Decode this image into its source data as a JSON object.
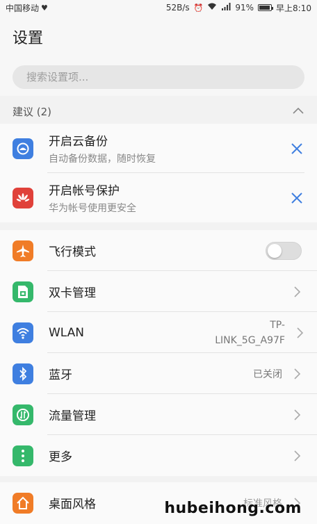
{
  "status_bar": {
    "carrier": "中国移动",
    "speed": "52B/s",
    "battery": "91%",
    "time": "早上8:10"
  },
  "header": {
    "title": "设置"
  },
  "search": {
    "placeholder": "搜索设置项..."
  },
  "suggestions": {
    "header": "建议 (2)",
    "items": [
      {
        "title": "开启云备份",
        "subtitle": "自动备份数据，随时恢复",
        "icon": "cloud-backup-icon",
        "color": "#3f7fe0"
      },
      {
        "title": "开启帐号保护",
        "subtitle": "华为帐号使用更安全",
        "icon": "huawei-icon",
        "color": "#e0413a"
      }
    ]
  },
  "settings": {
    "items": [
      {
        "label": "飞行模式",
        "icon": "airplane-icon",
        "color": "#f07c27",
        "toggle": false
      },
      {
        "label": "双卡管理",
        "icon": "sim-card-icon",
        "color": "#35b86b"
      },
      {
        "label": "WLAN",
        "icon": "wifi-icon",
        "color": "#3f7fe0",
        "value_line1": "TP-",
        "value_line2": "LINK_5G_A97F"
      },
      {
        "label": "蓝牙",
        "icon": "bluetooth-icon",
        "color": "#3f7fe0",
        "value": "已关闭"
      },
      {
        "label": "流量管理",
        "icon": "data-usage-icon",
        "color": "#35b86b"
      },
      {
        "label": "更多",
        "icon": "more-icon",
        "color": "#35b86b"
      }
    ]
  },
  "display": {
    "items": [
      {
        "label": "桌面风格",
        "icon": "home-icon",
        "color": "#f07c27",
        "value": "标准风格"
      }
    ]
  },
  "watermark": "hubeihong.com"
}
